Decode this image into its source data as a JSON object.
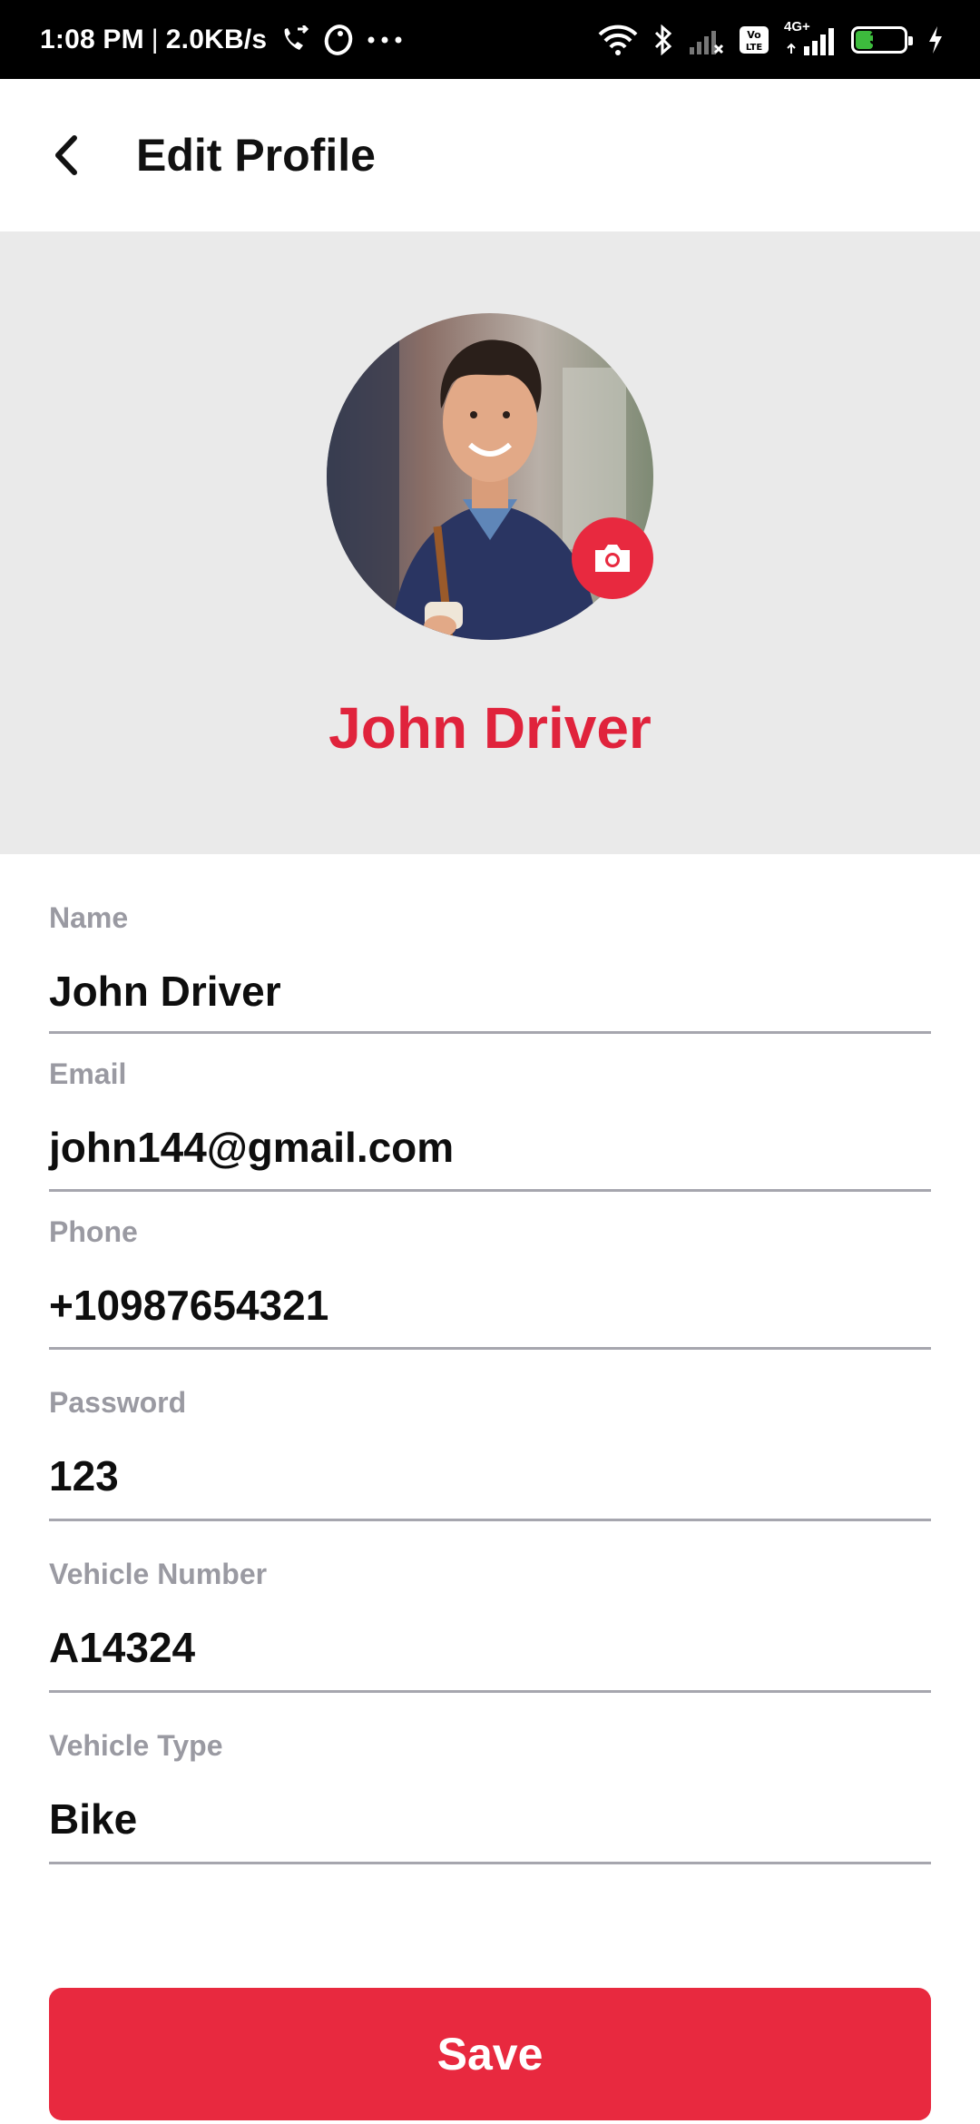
{
  "status_bar": {
    "time": "1:08 PM",
    "separator": "|",
    "speed": "2.0KB/s",
    "battery": "32",
    "network_label": "4G+",
    "icons": [
      "call-forward-icon",
      "app-icon",
      "more-dots-icon",
      "wifi-icon",
      "bluetooth-icon",
      "signal-weak-icon",
      "volte-icon",
      "signal-icon",
      "battery-icon",
      "charging-icon"
    ]
  },
  "app_bar": {
    "title": "Edit Profile",
    "back_icon": "arrow-back-icon"
  },
  "profile": {
    "display_name": "John Driver",
    "camera_icon": "camera-icon"
  },
  "form": {
    "fields": [
      {
        "label": "Name",
        "value": "John Driver"
      },
      {
        "label": "Email",
        "value": "john144@gmail.com"
      },
      {
        "label": "Phone",
        "value": "+10987654321"
      },
      {
        "label": "Password",
        "value": "123"
      },
      {
        "label": "Vehicle Number",
        "value": "A14324"
      },
      {
        "label": "Vehicle Type",
        "value": "Bike"
      }
    ]
  },
  "actions": {
    "save_label": "Save"
  },
  "colors": {
    "accent": "#e8293f",
    "header_bg": "#eaeaea",
    "label_gray": "#9a9aa2"
  }
}
